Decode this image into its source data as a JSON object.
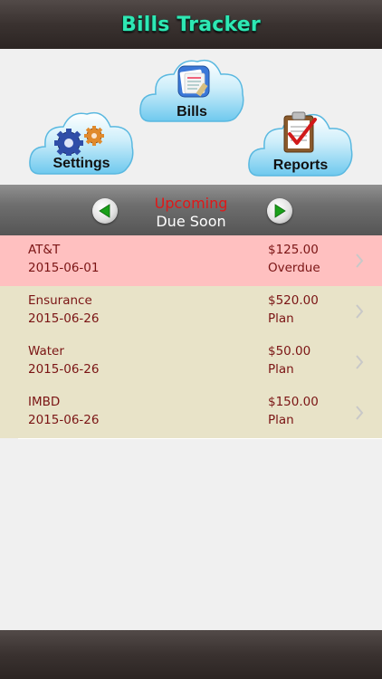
{
  "header": {
    "title": "Bills Tracker"
  },
  "menu": {
    "bills_label": "Bills",
    "settings_label": "Settings",
    "reports_label": "Reports"
  },
  "nav": {
    "title": "Upcoming",
    "subtitle": "Due Soon",
    "prev_icon": "green-left-arrow-icon",
    "next_icon": "green-right-arrow-icon"
  },
  "bills": [
    {
      "name": "AT&T",
      "date": "2015-06-01",
      "amount": "$125.00",
      "status": "Overdue",
      "color": "#ffc0c0"
    },
    {
      "name": "Ensurance",
      "date": "2015-06-26",
      "amount": "$520.00",
      "status": "Plan",
      "color": "#e8e3c8"
    },
    {
      "name": "Water",
      "date": "2015-06-26",
      "amount": "$50.00",
      "status": "Plan",
      "color": "#e8e3c8"
    },
    {
      "name": "IMBD",
      "date": "2015-06-26",
      "amount": "$150.00",
      "status": "Plan",
      "color": "#e8e3c8"
    }
  ],
  "colors": {
    "header_title": "#2ee8b4",
    "nav_title": "#e01818",
    "row_text": "#7a1414",
    "overdue_bg": "#ffc0c0",
    "plan_bg": "#e8e3c8"
  }
}
